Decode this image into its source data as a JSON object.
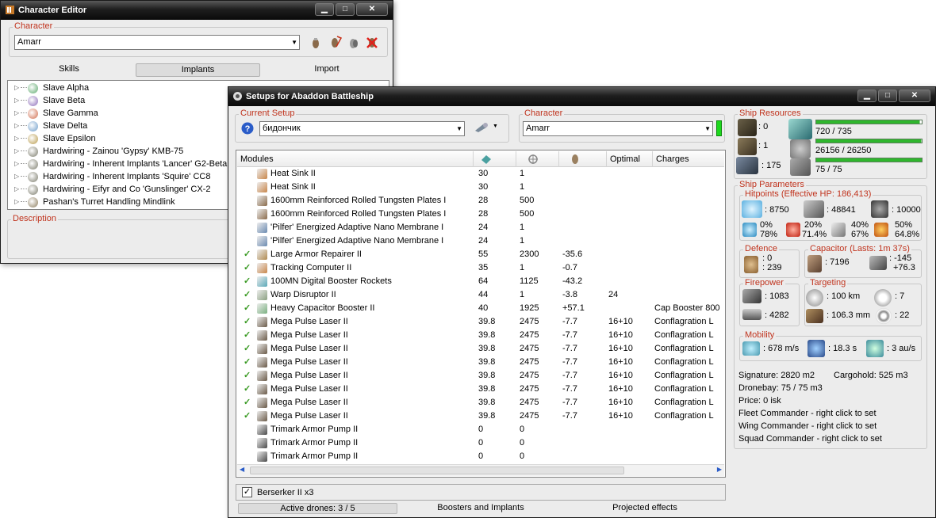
{
  "char_editor": {
    "title": "Character Editor",
    "character_group": "Character",
    "character_value": "Amarr",
    "tabs": [
      "Skills",
      "Implants",
      "Import"
    ],
    "tree_items": [
      "Slave Alpha",
      "Slave Beta",
      "Slave Gamma",
      "Slave Delta",
      "Slave Epsilon",
      "Hardwiring - Zainou 'Gypsy' KMB-75",
      "Hardwiring - Inherent Implants 'Lancer' G2-Beta",
      "Hardwiring - Inherent Implants 'Squire' CC8",
      "Hardwiring - Eifyr and Co 'Gunslinger' CX-2",
      "Pashan's Turret Handling Mindlink"
    ],
    "description_label": "Description"
  },
  "setups": {
    "title": "Setups for Abaddon Battleship",
    "current_setup_label": "Current Setup",
    "current_setup_value": "бидончик",
    "character_label": "Character",
    "character_value": "Amarr",
    "columns": [
      "Modules",
      "",
      "",
      "",
      "Optimal",
      "Charges"
    ],
    "modules": [
      {
        "checked": false,
        "name": "Heat Sink II",
        "cpu": "30",
        "pg": "1",
        "cap": "",
        "optimal": "",
        "charges": "",
        "icon": "#c8864a"
      },
      {
        "checked": false,
        "name": "Heat Sink II",
        "cpu": "30",
        "pg": "1",
        "cap": "",
        "optimal": "",
        "charges": "",
        "icon": "#c8864a"
      },
      {
        "checked": false,
        "name": "1600mm Reinforced Rolled Tungsten Plates I",
        "cpu": "28",
        "pg": "500",
        "cap": "",
        "optimal": "",
        "charges": "",
        "icon": "#8a6a4a"
      },
      {
        "checked": false,
        "name": "1600mm Reinforced Rolled Tungsten Plates I",
        "cpu": "28",
        "pg": "500",
        "cap": "",
        "optimal": "",
        "charges": "",
        "icon": "#8a6a4a"
      },
      {
        "checked": false,
        "name": "'Pilfer' Energized Adaptive Nano Membrane I",
        "cpu": "24",
        "pg": "1",
        "cap": "",
        "optimal": "",
        "charges": "",
        "icon": "#6a8ab0"
      },
      {
        "checked": false,
        "name": "'Pilfer' Energized Adaptive Nano Membrane I",
        "cpu": "24",
        "pg": "1",
        "cap": "",
        "optimal": "",
        "charges": "",
        "icon": "#6a8ab0"
      },
      {
        "checked": true,
        "name": "Large Armor Repairer II",
        "cpu": "55",
        "pg": "2300",
        "cap": "-35.6",
        "optimal": "",
        "charges": "",
        "icon": "#b08a50"
      },
      {
        "checked": true,
        "name": "Tracking Computer II",
        "cpu": "35",
        "pg": "1",
        "cap": "-0.7",
        "optimal": "",
        "charges": "",
        "icon": "#c8864a"
      },
      {
        "checked": true,
        "name": "100MN Digital Booster Rockets",
        "cpu": "64",
        "pg": "1125",
        "cap": "-43.2",
        "optimal": "",
        "charges": "",
        "icon": "#5aa8b8"
      },
      {
        "checked": true,
        "name": "Warp Disruptor II",
        "cpu": "44",
        "pg": "1",
        "cap": "-3.8",
        "optimal": "24",
        "charges": "",
        "icon": "#8aa080"
      },
      {
        "checked": true,
        "name": "Heavy Capacitor Booster II",
        "cpu": "40",
        "pg": "1925",
        "cap": "+57.1",
        "optimal": "",
        "charges": "Cap Booster 800",
        "icon": "#7ab080"
      },
      {
        "checked": true,
        "name": "Mega Pulse Laser II",
        "cpu": "39.8",
        "pg": "2475",
        "cap": "-7.7",
        "optimal": "16+10",
        "charges": "Conflagration L",
        "icon": "#6a5a48"
      },
      {
        "checked": true,
        "name": "Mega Pulse Laser II",
        "cpu": "39.8",
        "pg": "2475",
        "cap": "-7.7",
        "optimal": "16+10",
        "charges": "Conflagration L",
        "icon": "#6a5a48"
      },
      {
        "checked": true,
        "name": "Mega Pulse Laser II",
        "cpu": "39.8",
        "pg": "2475",
        "cap": "-7.7",
        "optimal": "16+10",
        "charges": "Conflagration L",
        "icon": "#6a5a48"
      },
      {
        "checked": true,
        "name": "Mega Pulse Laser II",
        "cpu": "39.8",
        "pg": "2475",
        "cap": "-7.7",
        "optimal": "16+10",
        "charges": "Conflagration L",
        "icon": "#6a5a48"
      },
      {
        "checked": true,
        "name": "Mega Pulse Laser II",
        "cpu": "39.8",
        "pg": "2475",
        "cap": "-7.7",
        "optimal": "16+10",
        "charges": "Conflagration L",
        "icon": "#6a5a48"
      },
      {
        "checked": true,
        "name": "Mega Pulse Laser II",
        "cpu": "39.8",
        "pg": "2475",
        "cap": "-7.7",
        "optimal": "16+10",
        "charges": "Conflagration L",
        "icon": "#6a5a48"
      },
      {
        "checked": true,
        "name": "Mega Pulse Laser II",
        "cpu": "39.8",
        "pg": "2475",
        "cap": "-7.7",
        "optimal": "16+10",
        "charges": "Conflagration L",
        "icon": "#6a5a48"
      },
      {
        "checked": true,
        "name": "Mega Pulse Laser II",
        "cpu": "39.8",
        "pg": "2475",
        "cap": "-7.7",
        "optimal": "16+10",
        "charges": "Conflagration L",
        "icon": "#6a5a48"
      },
      {
        "checked": false,
        "name": "Trimark Armor Pump II",
        "cpu": "0",
        "pg": "0",
        "cap": "",
        "optimal": "",
        "charges": "",
        "icon": "#4a4a4a"
      },
      {
        "checked": false,
        "name": "Trimark Armor Pump II",
        "cpu": "0",
        "pg": "0",
        "cap": "",
        "optimal": "",
        "charges": "",
        "icon": "#4a4a4a"
      },
      {
        "checked": false,
        "name": "Trimark Armor Pump II",
        "cpu": "0",
        "pg": "0",
        "cap": "",
        "optimal": "",
        "charges": "",
        "icon": "#4a4a4a"
      }
    ],
    "drone_label": "Berserker II x3",
    "status_tabs": [
      "Active drones: 3 / 5",
      "Boosters and Implants",
      "Projected effects"
    ],
    "ship_resources": {
      "label": "Ship Resources",
      "hardpoints": [
        ": 0",
        ": 1",
        ": 175"
      ],
      "cpu": "720 / 735",
      "powergrid": "26156 / 26250",
      "calibration": "75 / 75",
      "cpu_fill": 0.98,
      "pg_fill": 0.996,
      "cal_fill": 1.0
    },
    "ship_parameters": {
      "label": "Ship Parameters",
      "hitpoints_label": "Hitpoints (Effective HP: 186,413)",
      "hp": [
        ": 8750",
        ": 48841",
        ": 10000"
      ],
      "resists": [
        {
          "a": "0%",
          "b": "78%"
        },
        {
          "a": "20%",
          "b": "71.4%"
        },
        {
          "a": "40%",
          "b": "67%"
        },
        {
          "a": "50%",
          "b": "64.8%"
        }
      ],
      "defence_label": "Defence",
      "defence": [
        ": 0",
        ": 239"
      ],
      "capacitor_label": "Capacitor (Lasts: 1m 37s)",
      "capacitor": [
        ": 7196",
        ": -145",
        "+76.3"
      ],
      "firepower_label": "Firepower",
      "firepower": [
        ": 1083",
        ": 4282"
      ],
      "targeting_label": "Targeting",
      "targeting": [
        ": 100 km",
        ": 7",
        ": 106.3 mm",
        ": 22"
      ],
      "mobility_label": "Mobility",
      "mobility": [
        ": 678 m/s",
        ": 18.3 s",
        ": 3 au/s"
      ],
      "signature": "Signature: 2820 m2",
      "cargohold": "Cargohold: 525 m3",
      "dronebay": "Dronebay: 75 / 75 m3",
      "price": "Price: 0 isk",
      "fleet": "Fleet Commander - right click to set",
      "wing": "Wing Commander - right click to set",
      "squad": "Squad Commander - right click to set"
    }
  }
}
